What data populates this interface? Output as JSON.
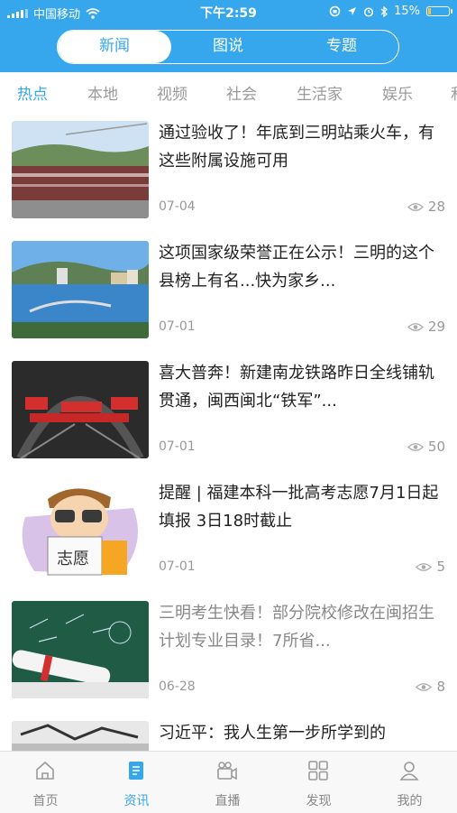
{
  "status": {
    "carrier": "中国移动",
    "time": "下午2:59",
    "battery": "15%",
    "battery_level": 0.15
  },
  "segments": [
    {
      "label": "新闻"
    },
    {
      "label": "图说"
    },
    {
      "label": "专题"
    }
  ],
  "categories": [
    {
      "label": "热点"
    },
    {
      "label": "本地"
    },
    {
      "label": "视频"
    },
    {
      "label": "社会"
    },
    {
      "label": "生活家"
    },
    {
      "label": "娱乐"
    },
    {
      "label": "和"
    }
  ],
  "articles": [
    {
      "title": "通过验收了！年底到三明站乘火车，有这些附属设施可用",
      "date": "07-04",
      "views": "28",
      "thumb": "train-station-photo"
    },
    {
      "title": "这项国家级荣誉正在公示！三明的这个县榜上有名...快为家乡...",
      "date": "07-01",
      "views": "29",
      "thumb": "river-city-photo"
    },
    {
      "title": "喜大普奔！新建南龙铁路昨日全线铺轨贯通，闽西闽北“铁军”...",
      "date": "07-01",
      "views": "50",
      "thumb": "railway-tunnel-photo"
    },
    {
      "title": "提醒 | 福建本科一批高考志愿7月1日起填报 3日18时截止",
      "date": "07-01",
      "views": "5",
      "thumb": "cartoon-student-志愿"
    },
    {
      "title": "三明考生快看！部分院校修改在闽招生计划专业目录！7所省...",
      "date": "06-28",
      "views": "8",
      "thumb": "chalkboard-diploma-photo"
    },
    {
      "title": "习近平：我人生第一步所学到的",
      "date": "",
      "views": "",
      "thumb": "bw-photo"
    }
  ],
  "tabs": [
    {
      "label": "首页",
      "icon": "home-icon"
    },
    {
      "label": "资讯",
      "icon": "news-icon"
    },
    {
      "label": "直播",
      "icon": "camera-icon"
    },
    {
      "label": "发现",
      "icon": "grid-icon"
    },
    {
      "label": "我的",
      "icon": "user-icon"
    }
  ],
  "colors": {
    "accent": "#36a7ec"
  }
}
